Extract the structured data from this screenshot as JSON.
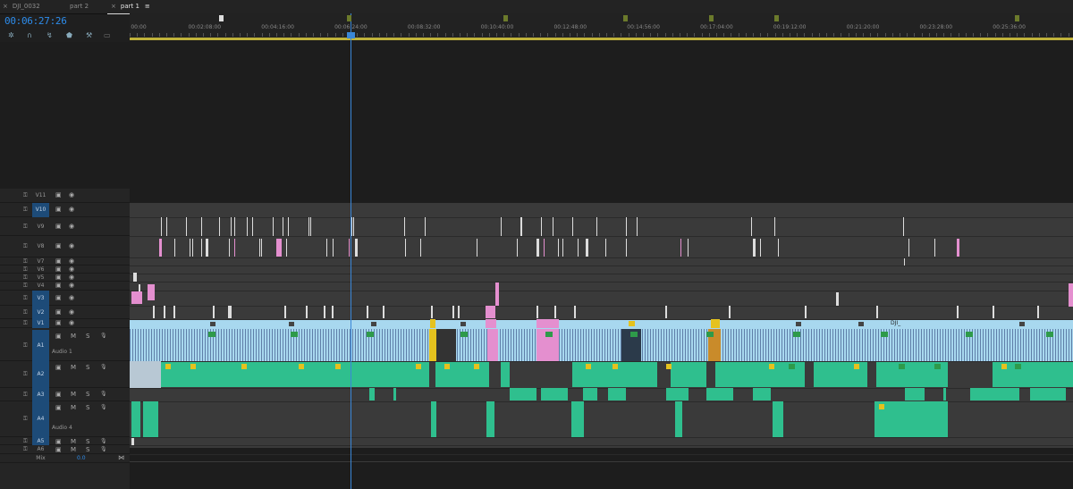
{
  "tabs": [
    {
      "label": "DJI_0032",
      "active": false
    },
    {
      "label": "part 2",
      "active": false
    },
    {
      "label": "part 1",
      "active": true
    }
  ],
  "timecode": "00:06:27:26",
  "ruler_labels": [
    "00:00",
    "00:02:08:00",
    "00:04:16:00",
    "00:06:24:00",
    "00:08:32:00",
    "00:10:40:00",
    "00:12:48:00",
    "00:14:56:00",
    "00:17:04:00",
    "00:19:12:00",
    "00:21:20:00",
    "00:23:28:00",
    "00:25:36:00",
    "00:2"
  ],
  "tracks": {
    "video": [
      "V11",
      "V10",
      "V9",
      "V8",
      "V7",
      "V6",
      "V5",
      "V4",
      "V3",
      "V2",
      "V1"
    ],
    "audio": [
      "A1",
      "A2",
      "A3",
      "A4",
      "A5",
      "A6"
    ],
    "audio1_name": "Audio 1",
    "audio4_name": "Audio 4",
    "mix_label": "Mix",
    "mix_value": "0.0",
    "mute": "M",
    "solo": "S"
  },
  "clip_label": "DJI_",
  "fx_label": "fx",
  "colors": {
    "accent": "#2d8ceb",
    "video_clip": "#a8d8ef",
    "audio_clip": "#2fbf8e",
    "pink": "#e48fcf",
    "yellow": "#e5c21e"
  }
}
